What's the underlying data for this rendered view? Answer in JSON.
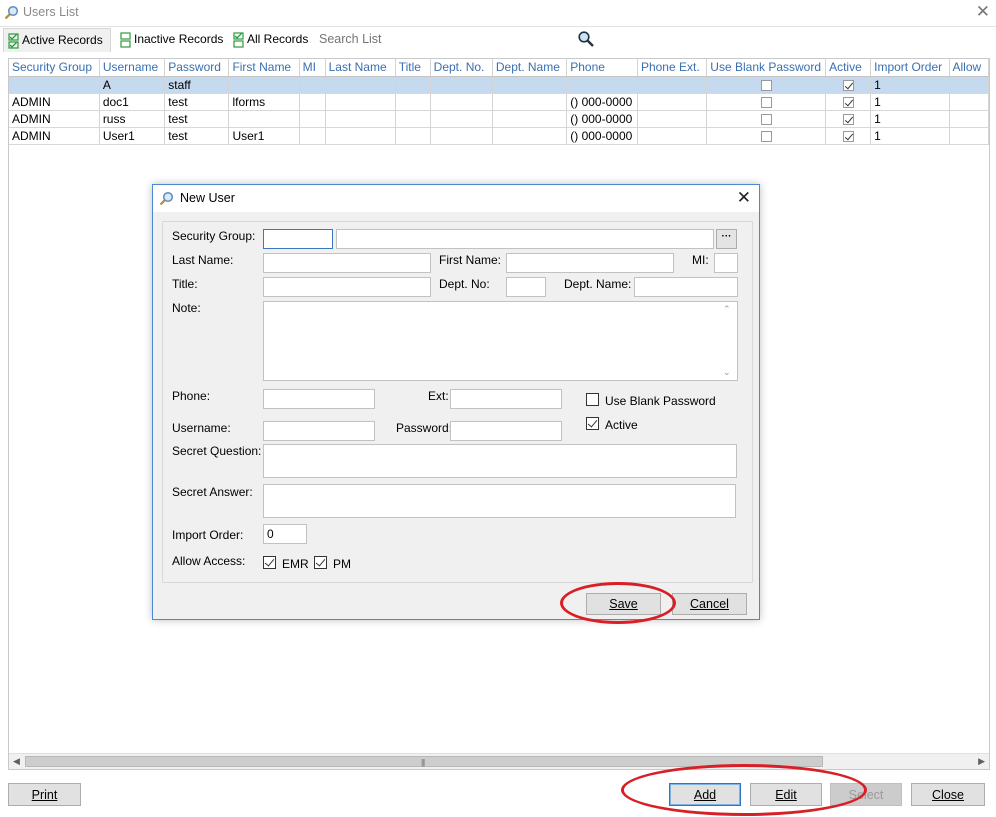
{
  "window": {
    "title": "Users List",
    "close_glyph": "✕",
    "icon": "magnifier-icon"
  },
  "tabs": [
    {
      "label": "Active Records",
      "active": true
    },
    {
      "label": "Inactive Records",
      "active": false
    },
    {
      "label": "All Records",
      "active": false
    }
  ],
  "search": {
    "placeholder": "Search List",
    "icon": "search-icon"
  },
  "grid": {
    "columns": [
      "Security Group",
      "Username",
      "Password",
      "First Name",
      "MI",
      "Last Name",
      "Title",
      "Dept. No.",
      "Dept. Name",
      "Phone",
      "Phone Ext.",
      "Use Blank Password",
      "Active",
      "Import Order",
      "Allow"
    ],
    "rows": [
      {
        "security_group": "",
        "username": "A",
        "password": "staff",
        "first_name": "",
        "phone": "",
        "use_blank_password": false,
        "active": true,
        "import_order": "1",
        "selected": true
      },
      {
        "security_group": "ADMIN",
        "username": "doc1",
        "password": "test",
        "first_name": "lforms",
        "phone": "() 000-0000",
        "use_blank_password": false,
        "active": true,
        "import_order": "1",
        "selected": false
      },
      {
        "security_group": "ADMIN",
        "username": "russ",
        "password": "test",
        "first_name": "",
        "phone": "() 000-0000",
        "use_blank_password": false,
        "active": true,
        "import_order": "1",
        "selected": false
      },
      {
        "security_group": "ADMIN",
        "username": "User1",
        "password": "test",
        "first_name": "User1",
        "phone": "() 000-0000",
        "use_blank_password": false,
        "active": true,
        "import_order": "1",
        "selected": false
      }
    ]
  },
  "bottom_buttons": {
    "print": "Print",
    "add": "Add",
    "edit": "Edit",
    "select": "Select",
    "close": "Close"
  },
  "dialog": {
    "title": "New User",
    "close_glyph": "✕",
    "labels": {
      "security_group": "Security Group:",
      "last_name": "Last Name:",
      "first_name": "First Name:",
      "mi": "MI:",
      "title": "Title:",
      "dept_no": "Dept. No:",
      "dept_name": "Dept. Name:",
      "note": "Note:",
      "phone": "Phone:",
      "ext": "Ext:",
      "use_blank_password": "Use Blank Password",
      "username": "Username:",
      "password": "Password:",
      "active": "Active",
      "secret_question": "Secret Question:",
      "secret_answer": "Secret Answer:",
      "import_order": "Import Order:",
      "allow_access": "Allow Access:",
      "emr": "EMR",
      "pm": "PM"
    },
    "values": {
      "security_group_code": "",
      "security_group_name": "",
      "last_name": "",
      "first_name": "",
      "mi": "",
      "title": "",
      "dept_no": "",
      "dept_name": "",
      "note": "",
      "phone": "",
      "ext": "",
      "username": "",
      "password": "",
      "secret_question": "",
      "secret_answer": "",
      "import_order": "0",
      "use_blank_password": false,
      "active": true,
      "emr": true,
      "pm": true
    },
    "ellipsis_label": "···",
    "buttons": {
      "save": "Save",
      "cancel": "Cancel"
    }
  },
  "colors": {
    "header_text": "#3a6fb0",
    "selected_row": "#c5d9ef",
    "annotation_red": "#d81f26",
    "dialog_border": "#4a8ad4"
  }
}
